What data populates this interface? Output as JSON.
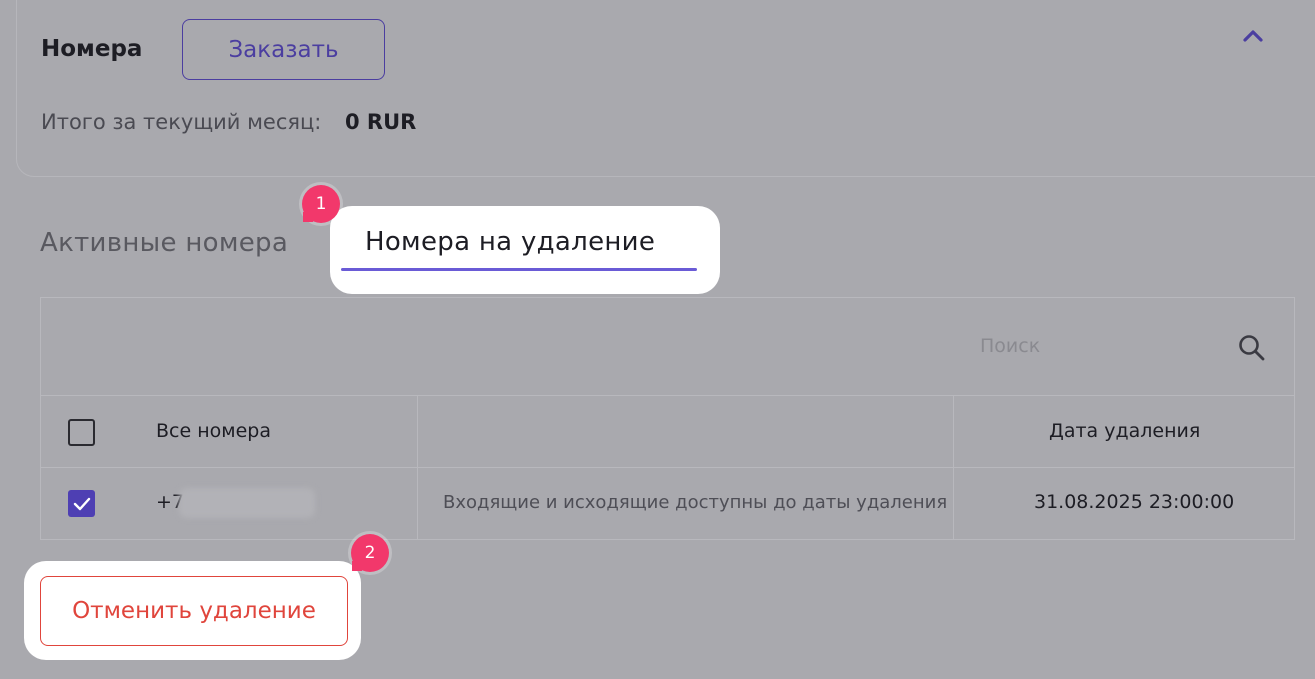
{
  "section": {
    "title": "Номера",
    "order_label": "Заказать",
    "total_label": "Итого за текущий месяц:",
    "total_value": "0 RUR"
  },
  "tabs": [
    {
      "label": "Активные номера",
      "active": false
    },
    {
      "label": "Номера на удаление",
      "active": true
    }
  ],
  "markers": [
    "1",
    "2"
  ],
  "search": {
    "placeholder": "Поиск"
  },
  "table": {
    "columns": [
      "Все номера",
      "",
      "Дата удаления"
    ],
    "rows": [
      {
        "checked": true,
        "number_prefix": "+7",
        "description": "Входящие и исходящие доступны до даты удаления",
        "deletion_date": "31.08.2025 23:00:00"
      }
    ]
  },
  "actions": {
    "cancel_label": "Отменить удаление"
  },
  "colors": {
    "accent": "#6a5bd6",
    "primary_text": "#4b3ea0",
    "danger": "#e0453c",
    "marker": "#f2386b",
    "overlay": "#a9a9ae"
  },
  "icons": [
    "chevron-up-icon",
    "search-icon",
    "checkmark-icon"
  ]
}
